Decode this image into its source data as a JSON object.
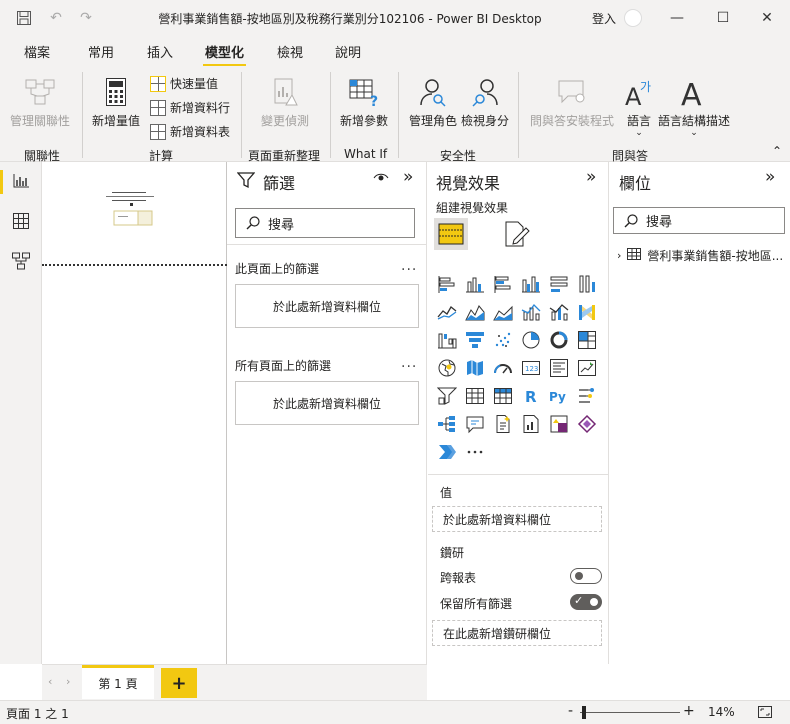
{
  "window": {
    "title": "營利事業銷售額-按地區別及稅務行業別分102106 - Power BI Desktop",
    "sign_in": "登入"
  },
  "menu": {
    "tabs": [
      {
        "label": "檔案"
      },
      {
        "label": "常用"
      },
      {
        "label": "插入"
      },
      {
        "label": "模型化",
        "active": true
      },
      {
        "label": "檢視"
      },
      {
        "label": "說明"
      }
    ]
  },
  "ribbon": {
    "manage_relationships": "管理關聯性",
    "new_measure": "新增量值",
    "quick_measure": "快速量值",
    "new_column": "新增資料行",
    "new_table": "新增資料表",
    "change_detection": "變更偵測",
    "new_parameter": "新增參數",
    "manage_roles": "管理角色",
    "view_as": "檢視身分",
    "qa_setup": "問與答安裝程式",
    "language": "語言",
    "linguistic_schema": "語言結構描述",
    "groups": {
      "relationships": "關聯性",
      "calculations": "計算",
      "page_refresh": "頁面重新整理",
      "whatif": "What If",
      "security": "安全性",
      "qa": "問與答"
    }
  },
  "filters": {
    "title": "篩選",
    "search_placeholder": "搜尋",
    "this_page": "此頁面上的篩選",
    "all_pages": "所有頁面上的篩選",
    "add_fields": "於此處新增資料欄位",
    "more": "..."
  },
  "visualizations": {
    "title": "視覺效果",
    "build_visual": "組建視覺效果",
    "more": "...",
    "values_label": "值",
    "values_well": "於此處新增資料欄位",
    "drill_label": "鑽研",
    "cross_report": "跨報表",
    "cross_report_on": false,
    "keep_all_filters": "保留所有篩選",
    "keep_all_filters_on": true,
    "drill_well": "在此處新增鑽研欄位"
  },
  "fields": {
    "title": "欄位",
    "search_placeholder": "搜尋",
    "tables": [
      {
        "name": "營利事業銷售額-按地區..."
      }
    ]
  },
  "pages": {
    "tabs": [
      {
        "label": "第 1 頁"
      }
    ],
    "add": "+"
  },
  "status": {
    "page_indicator": "頁面 1 之 1",
    "zoom_minus": "-",
    "zoom_plus": "+",
    "zoom": "14%"
  },
  "colors": {
    "accent": "#f2c811",
    "chrome": "#f3f2f1"
  }
}
